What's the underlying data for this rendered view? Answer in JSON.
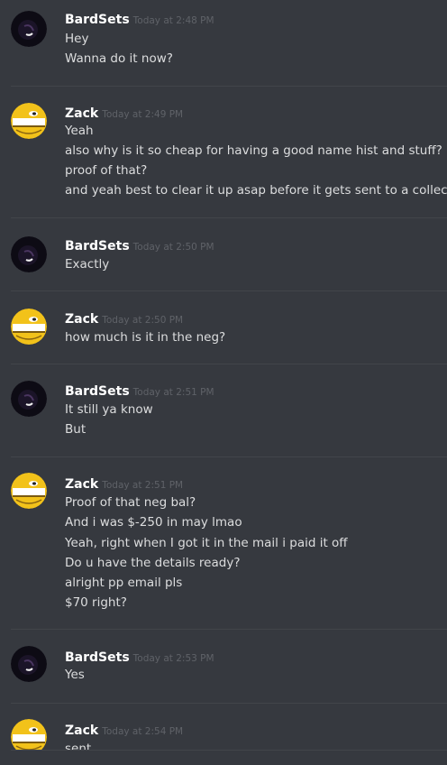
{
  "messages": [
    {
      "author": "BardSets",
      "avatar_icon": "bardsets-avatar-icon",
      "timestamp": "Today at 2:48 PM",
      "lines": [
        "Hey",
        "Wanna do it now?"
      ]
    },
    {
      "author": "Zack",
      "avatar_icon": "zack-avatar-icon",
      "timestamp": "Today at 2:49 PM",
      "lines": [
        "Yeah",
        "also why is it so cheap for having a good name hist and stuff?",
        "proof of that?",
        "and yeah best to clear it up asap before it gets sent to a collection ag"
      ]
    },
    {
      "author": "BardSets",
      "avatar_icon": "bardsets-avatar-icon",
      "timestamp": "Today at 2:50 PM",
      "lines": [
        "Exactly"
      ]
    },
    {
      "author": "Zack",
      "avatar_icon": "zack-avatar-icon",
      "timestamp": "Today at 2:50 PM",
      "lines": [
        "how much is it in the neg?"
      ]
    },
    {
      "author": "BardSets",
      "avatar_icon": "bardsets-avatar-icon",
      "timestamp": "Today at 2:51 PM",
      "lines": [
        "It still ya know",
        "But"
      ]
    },
    {
      "author": "Zack",
      "avatar_icon": "zack-avatar-icon",
      "timestamp": "Today at 2:51 PM",
      "lines": [
        "Proof of that neg bal?",
        "And i was $-250 in may lmao",
        "Yeah, right when I got it in the mail i paid it off",
        "Do u have the details ready?",
        "alright pp email pls",
        "$70 right?"
      ]
    },
    {
      "author": "BardSets",
      "avatar_icon": "bardsets-avatar-icon",
      "timestamp": "Today at 2:53 PM",
      "lines": [
        "Yes"
      ]
    },
    {
      "author": "Zack",
      "avatar_icon": "zack-avatar-icon",
      "timestamp": "Today at 2:54 PM",
      "lines": [
        "sent"
      ]
    }
  ]
}
